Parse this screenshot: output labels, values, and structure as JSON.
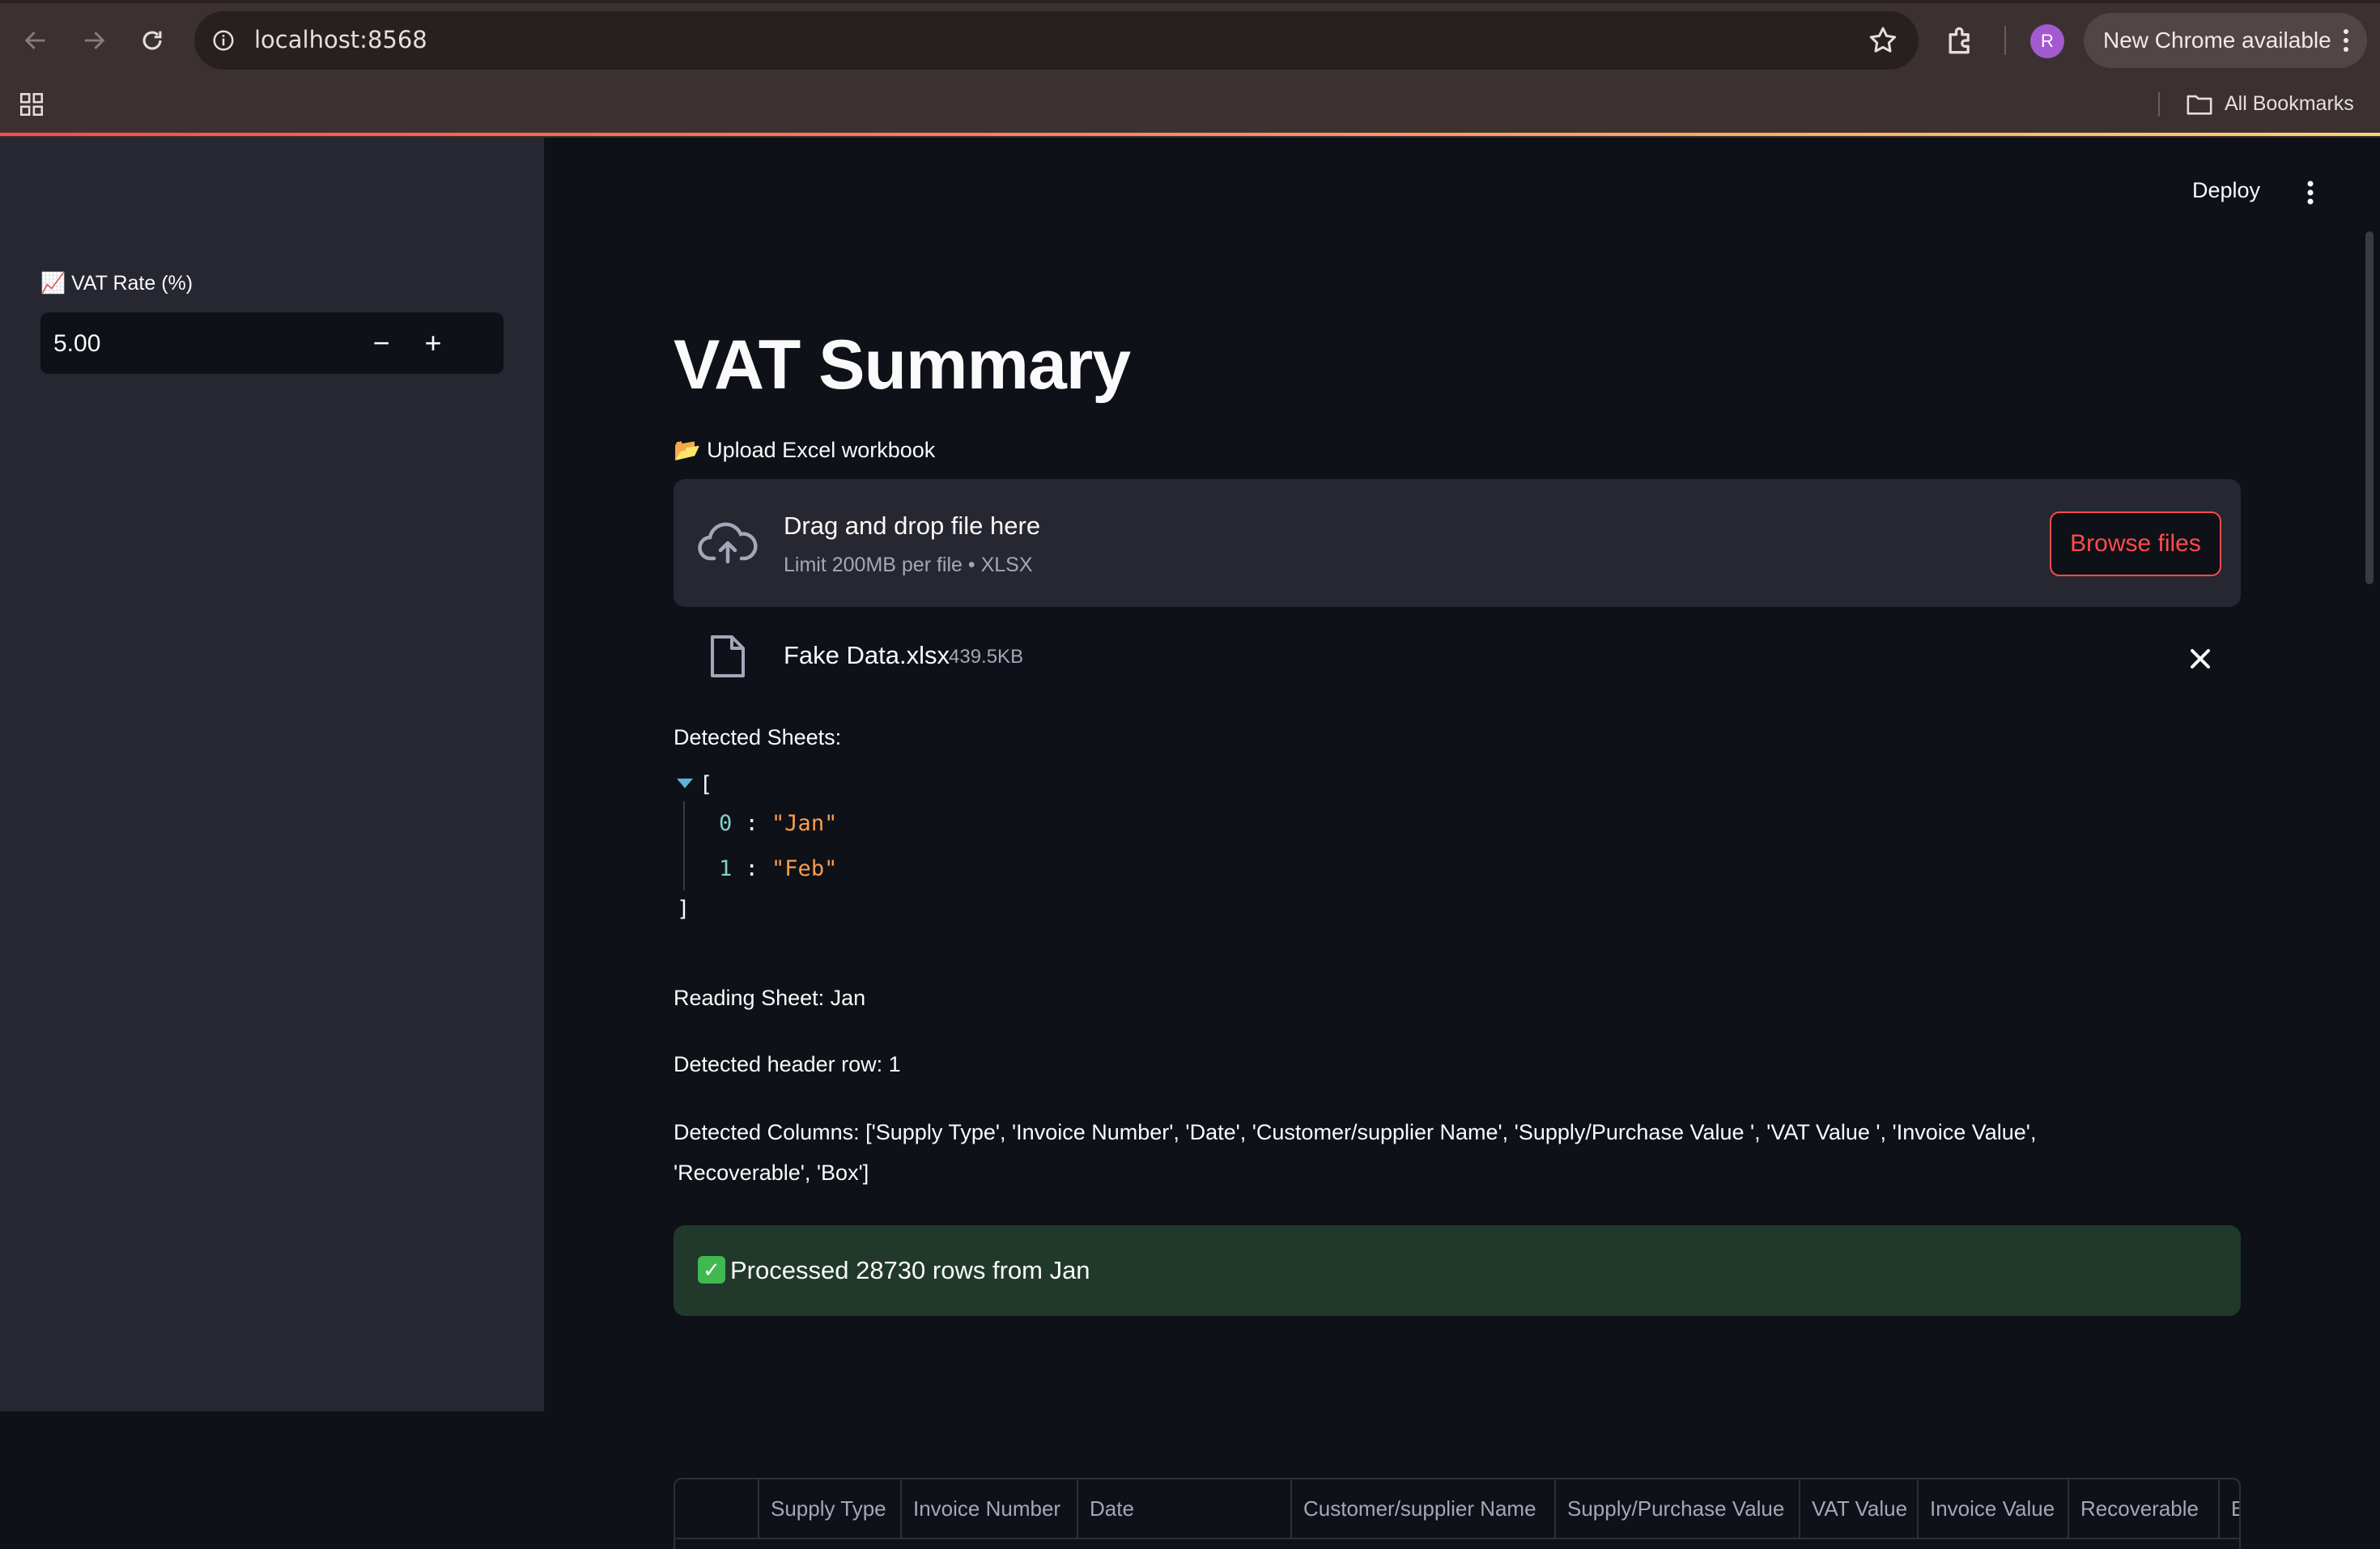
{
  "browser": {
    "url": "localhost:8568",
    "update_label": "New Chrome available",
    "profile_initial": "R",
    "bookmarks_label": "All Bookmarks"
  },
  "toolbar": {
    "deploy_label": "Deploy"
  },
  "sidebar": {
    "vat_label": "📈 VAT Rate (%)",
    "vat_value": "5.00",
    "decrement_label": "−",
    "increment_label": "+"
  },
  "main": {
    "title": "VAT Summary",
    "upload_label": "📂 Upload Excel workbook",
    "dropzone_title": "Drag and drop file here",
    "dropzone_sub": "Limit 200MB per file • XLSX",
    "browse_label": "Browse files",
    "file_name": "Fake Data.xlsx",
    "file_size": "439.5KB",
    "detected_sheets_label": "Detected Sheets:",
    "json_open": "[",
    "json_close": "]",
    "sheets": [
      {
        "index": "0",
        "value": "\"Jan\""
      },
      {
        "index": "1",
        "value": "\"Feb\""
      }
    ],
    "reading_sheet": "Reading Sheet: Jan",
    "header_row": "Detected header row: 1",
    "columns_line1": "Detected Columns: ['Supply Type', 'Invoice Number', 'Date', 'Customer/supplier Name', 'Supply/Purchase Value ', 'VAT Value ', 'Invoice Value',",
    "columns_line2": "'Recoverable', 'Box']",
    "success_text": "Processed 28730 rows from Jan",
    "table_headers": [
      "Supply Type",
      "Invoice Number",
      "Date",
      "Customer/supplier Name",
      "Supply/Purchase Value",
      "VAT Value",
      "Invoice Value",
      "Recoverable",
      "Box"
    ]
  },
  "colors": {
    "accent": "#ff4b4b",
    "success_bg": "#21392b",
    "sidebar_bg": "#262730",
    "main_bg": "#0e1117"
  }
}
